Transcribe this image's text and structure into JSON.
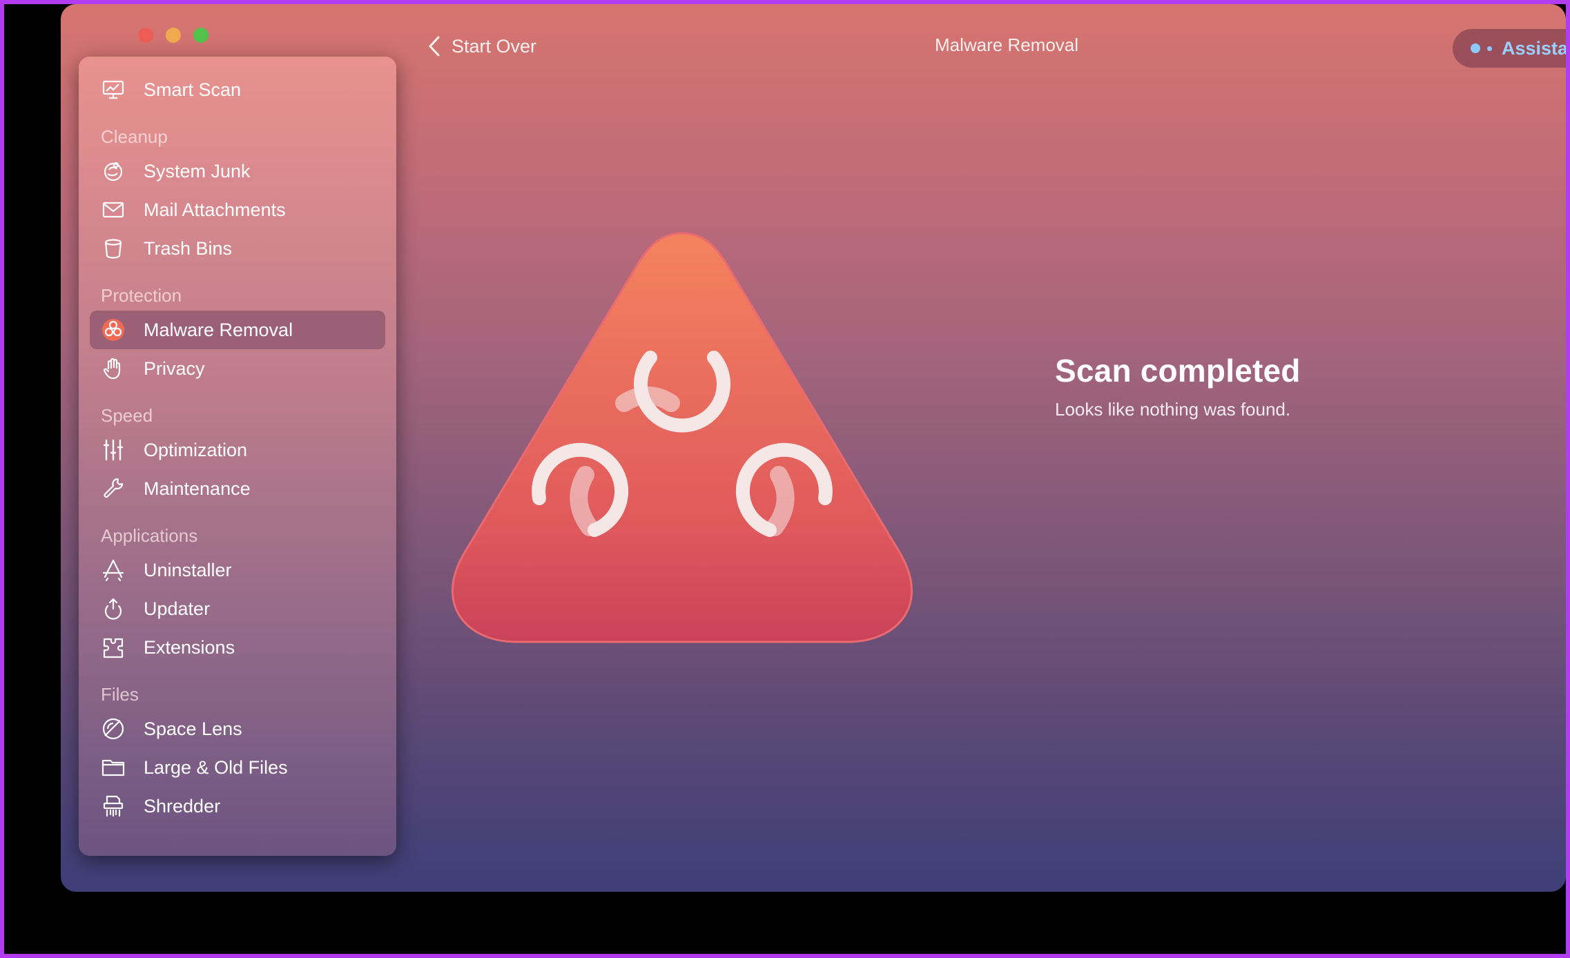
{
  "window": {
    "title": "Malware Removal"
  },
  "toolbar": {
    "back_label": "Start Over",
    "assistant_label": "Assistant"
  },
  "sidebar": {
    "top_item": {
      "label": "Smart Scan",
      "icon": "smart-scan-icon"
    },
    "sections": [
      {
        "label": "Cleanup",
        "items": [
          {
            "label": "System Junk",
            "icon": "system-junk-icon"
          },
          {
            "label": "Mail Attachments",
            "icon": "mail-icon"
          },
          {
            "label": "Trash Bins",
            "icon": "trash-icon"
          }
        ]
      },
      {
        "label": "Protection",
        "items": [
          {
            "label": "Malware Removal",
            "icon": "biohazard-icon",
            "active": true
          },
          {
            "label": "Privacy",
            "icon": "hand-icon"
          }
        ]
      },
      {
        "label": "Speed",
        "items": [
          {
            "label": "Optimization",
            "icon": "sliders-icon"
          },
          {
            "label": "Maintenance",
            "icon": "wrench-icon"
          }
        ]
      },
      {
        "label": "Applications",
        "items": [
          {
            "label": "Uninstaller",
            "icon": "app-store-icon"
          },
          {
            "label": "Updater",
            "icon": "update-icon"
          },
          {
            "label": "Extensions",
            "icon": "extension-icon"
          }
        ]
      },
      {
        "label": "Files",
        "items": [
          {
            "label": "Space Lens",
            "icon": "space-lens-icon"
          },
          {
            "label": "Large & Old Files",
            "icon": "folder-icon"
          },
          {
            "label": "Shredder",
            "icon": "shredder-icon"
          }
        ]
      }
    ]
  },
  "main": {
    "heading": "Scan completed",
    "subtext": "Looks like nothing was found."
  },
  "colors": {
    "accent": "#9ad0ff",
    "hazard_top": "#f4835f",
    "hazard_bottom": "#c9425a"
  }
}
